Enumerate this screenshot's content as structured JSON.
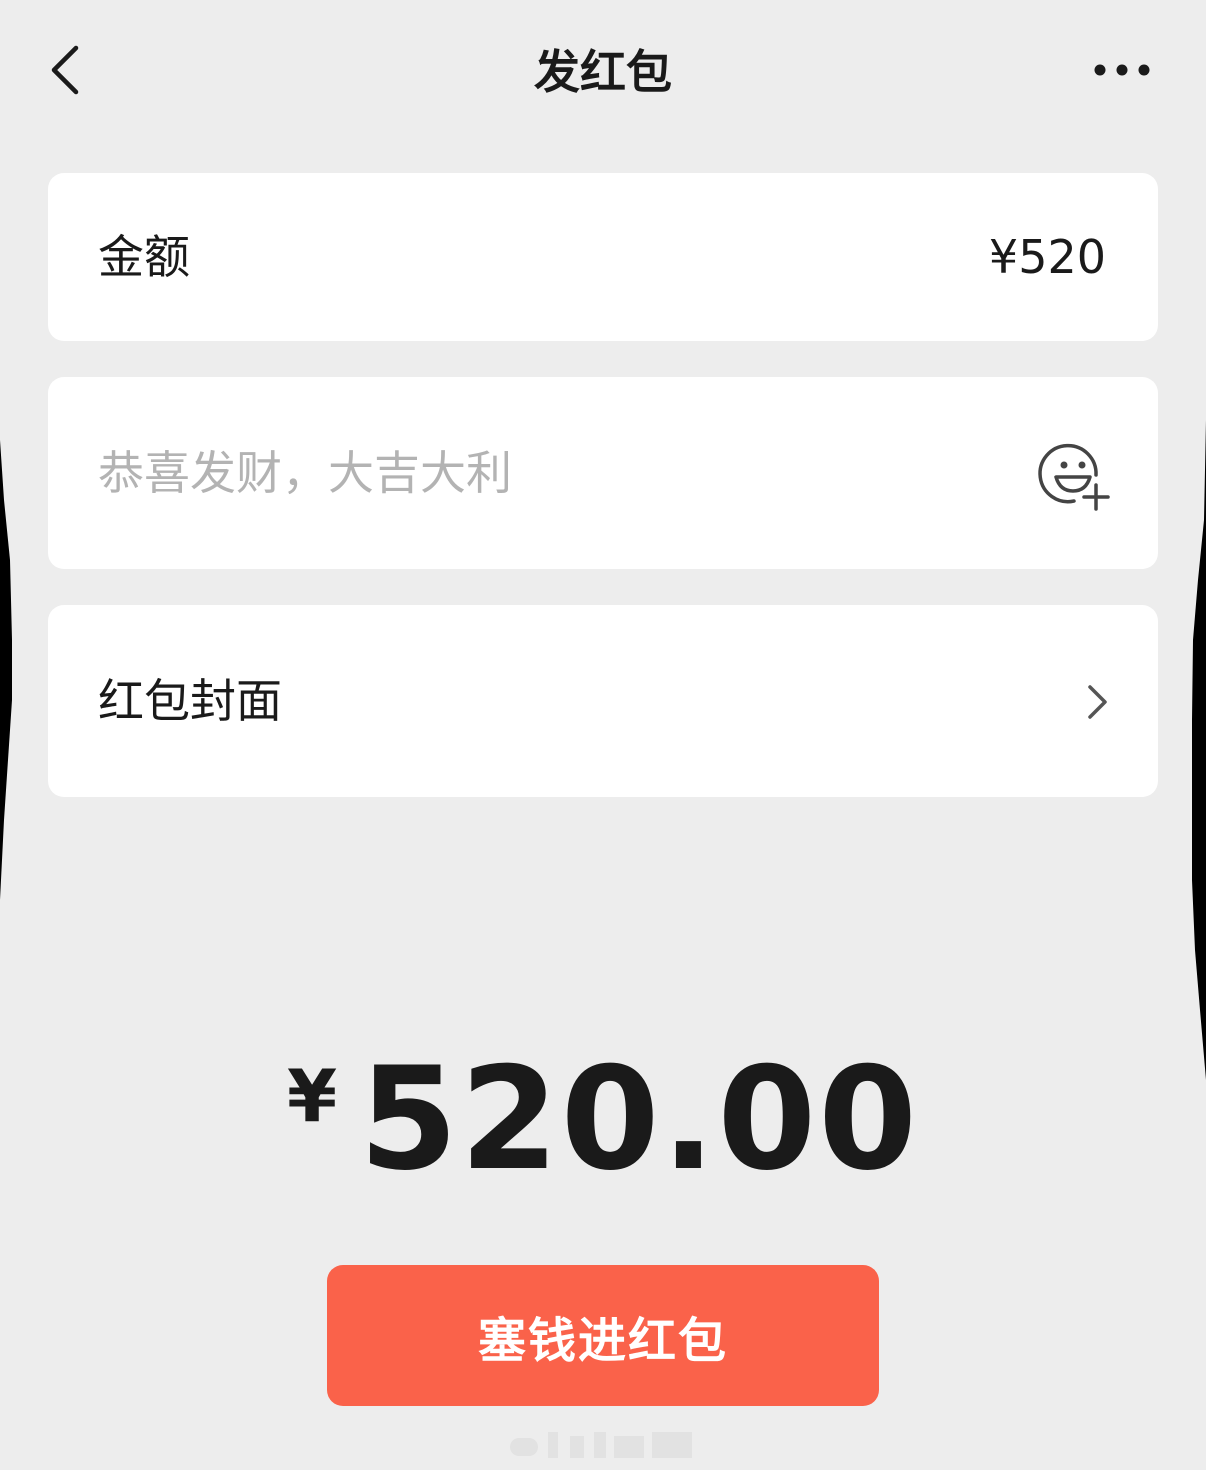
{
  "header": {
    "title": "发红包",
    "back_icon": "chevron-left-icon",
    "more_icon": "more-horizontal-icon"
  },
  "amount_card": {
    "label": "金额",
    "value": "¥520"
  },
  "message_card": {
    "placeholder": "恭喜发财，大吉大利",
    "value": "",
    "emoji_icon": "emoji-add-icon"
  },
  "cover_card": {
    "label": "红包封面",
    "chevron_icon": "chevron-right-icon"
  },
  "total": {
    "currency": "¥",
    "amount": "520.00"
  },
  "submit": {
    "label": "塞钱进红包"
  },
  "colors": {
    "background": "#ededed",
    "card": "#ffffff",
    "accent": "#fa624a",
    "text_primary": "#1a1a1a",
    "placeholder": "#b3b3b3"
  }
}
